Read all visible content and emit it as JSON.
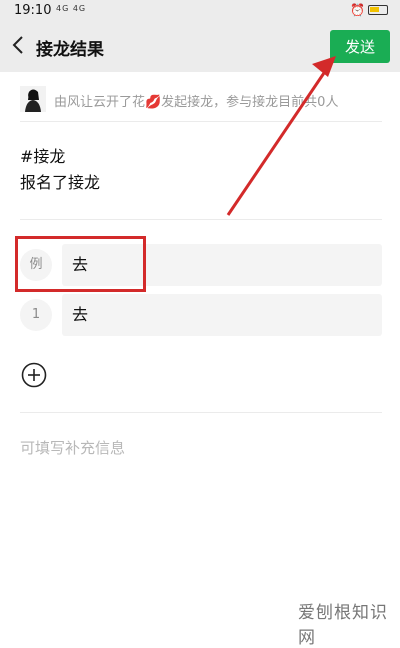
{
  "status_bar": {
    "time": "19:10",
    "signal": "4G 4G",
    "icons": "⋯ ◔"
  },
  "header": {
    "title": "接龙结果",
    "send_label": "发送"
  },
  "initiator": {
    "text": "由风让云开了花💋发起接龙，参与接龙目前共0人"
  },
  "content": {
    "line1": "#接龙",
    "line2": "报名了接龙"
  },
  "entries": [
    {
      "number": "例",
      "value": "去"
    },
    {
      "number": "1",
      "value": "去"
    }
  ],
  "extra_info_placeholder": "可填写补充信息",
  "watermark": "爱刨根知识网",
  "colors": {
    "accent": "#1aad54",
    "annotation": "#d32a2a"
  }
}
